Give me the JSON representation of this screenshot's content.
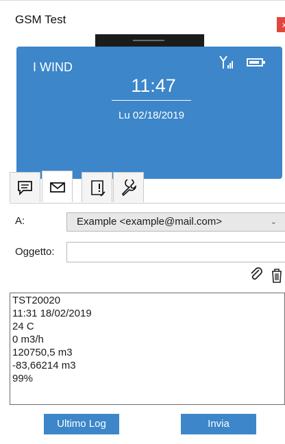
{
  "window": {
    "title": "GSM Test",
    "close_label": "x"
  },
  "phone": {
    "operator": "I WIND",
    "time": "11:47",
    "date": "Lu 02/18/2019",
    "icons": [
      "signal-icon",
      "battery-icon"
    ]
  },
  "tabs": [
    {
      "name": "sms",
      "icon": "sms-icon",
      "active": false
    },
    {
      "name": "email",
      "icon": "mail-icon",
      "active": true
    },
    {
      "name": "log",
      "icon": "log-icon",
      "active": false
    },
    {
      "name": "settings",
      "icon": "wrench-icon",
      "active": false
    }
  ],
  "form": {
    "to_label": "A:",
    "to_value": "Example <example@mail.com>",
    "subject_label": "Oggetto:",
    "subject_value": ""
  },
  "message": {
    "lines": [
      "TST20020",
      "11:31 18/02/2019",
      "24 C",
      "0 m3/h",
      "120750,5 m3",
      "-83,66214 m3",
      "99%"
    ]
  },
  "buttons": {
    "last_log": "Ultimo Log",
    "send": "Invia"
  },
  "colors": {
    "accent": "#3c86c9",
    "close": "#e0463c"
  }
}
